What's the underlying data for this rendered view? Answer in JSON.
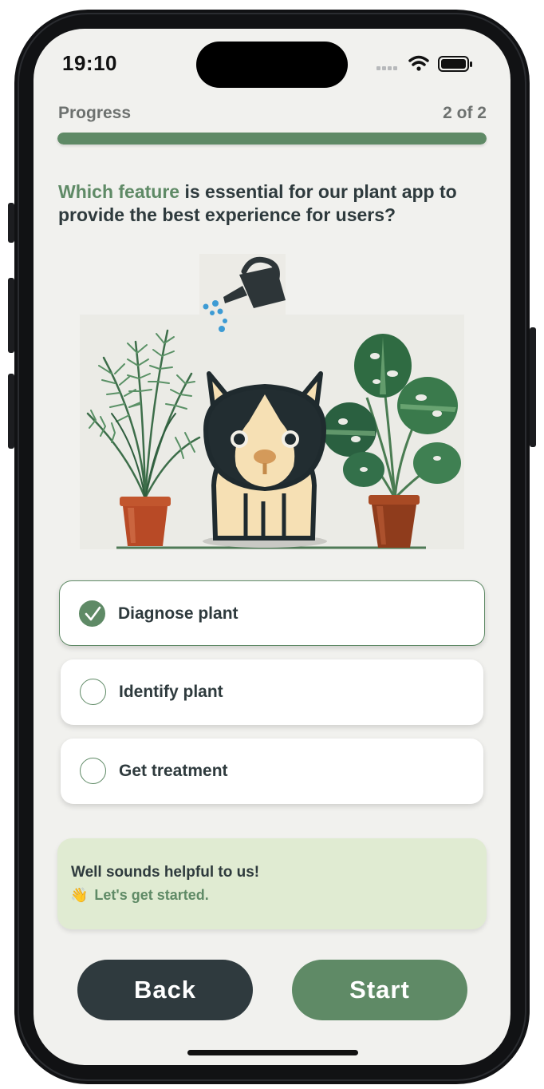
{
  "status_bar": {
    "time": "19:10",
    "icons": [
      "cellular-signal-icon",
      "wifi-icon",
      "battery-icon"
    ]
  },
  "progress": {
    "label": "Progress",
    "count": "2 of 2",
    "fraction": 1.0
  },
  "question": {
    "highlight": "Which feature",
    "rest": " is essential for our plant app to provide the best experience for users?"
  },
  "illustration": {
    "elements": [
      "watering-can-icon",
      "palm-plant",
      "dog-illustration",
      "monstera-plant"
    ]
  },
  "options": [
    {
      "label": "Diagnose plant",
      "selected": true
    },
    {
      "label": "Identify plant",
      "selected": false
    },
    {
      "label": "Get treatment",
      "selected": false
    }
  ],
  "feedback": {
    "line1": "Well sounds helpful to us!",
    "emoji": "👋",
    "line2": "Let's get started."
  },
  "buttons": {
    "back": "Back",
    "start": "Start"
  },
  "colors": {
    "accent": "#5f8a66",
    "dark": "#2f3a3e",
    "background": "#f1f1ee",
    "feedback_bg": "#e0ebd2"
  }
}
